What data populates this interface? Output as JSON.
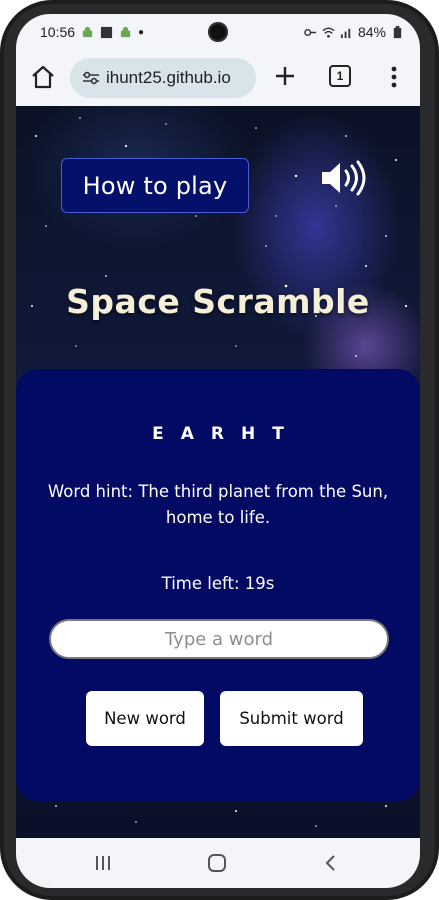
{
  "status_bar": {
    "time": "10:56",
    "battery": "84%"
  },
  "browser": {
    "url": "ihunt25.github.io",
    "tab_count": "1"
  },
  "game": {
    "how_to_play_label": "How to play",
    "title": "Space Scramble",
    "scrambled_word": "EARHT",
    "hint": "Word hint: The third planet from the Sun, home to life.",
    "timer": "Time left: 19s",
    "input_placeholder": "Type a word",
    "input_value": "",
    "new_word_label": "New word",
    "submit_word_label": "Submit word"
  },
  "colors": {
    "card_bg": "#020a64",
    "how_to_play_bg": "#04106a",
    "title_color": "#f6efd8"
  },
  "icons": {
    "sound": "speaker-volume-icon",
    "home": "home-icon",
    "site_settings": "tune-icon",
    "new_tab": "plus-icon",
    "menu": "more-vert-icon"
  }
}
